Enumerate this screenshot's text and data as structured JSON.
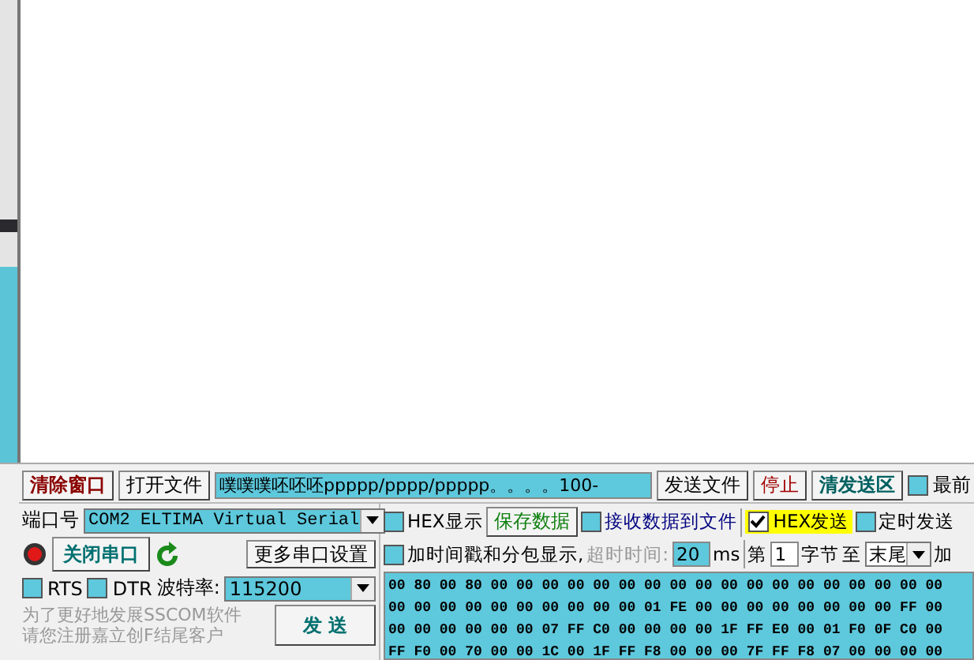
{
  "toolbar": {
    "clear_button": "清除窗口",
    "open_file_button": "打开文件",
    "send_input": "噗噗噗呸呸呸ppppp/pppp/ppppp。。。。100-",
    "send_file_button": "发送文件",
    "stop_button": "停止",
    "clear_send_button": "清发送区",
    "topmost": {
      "label": "最前",
      "checked": false
    }
  },
  "port": {
    "label": "端口号",
    "value": "COM2 ELTIMA Virtual Serial",
    "open": true,
    "close_button": "关闭串口",
    "more_button": "更多串口设置",
    "rts": {
      "label": "RTS",
      "checked": false
    },
    "dtr": {
      "label": "DTR",
      "checked": false
    },
    "baud_label": "波特率:",
    "baud_value": "115200"
  },
  "promo": [
    "为了更好地发展SSCOM软件",
    "请您注册嘉立创F结尾客户"
  ],
  "send_button": "发 送",
  "receive": {
    "hex_display": {
      "label": "HEX显示",
      "checked": false
    },
    "save_button": "保存数据",
    "to_file": {
      "label": "接收数据到文件",
      "checked": false
    },
    "timestamp": {
      "label": "加时间戳和分包显示,",
      "checked": false
    },
    "timeout_label": "超时时间:",
    "timeout_value": "20",
    "ms_label": "ms"
  },
  "send_options": {
    "hex_send": {
      "label": "HEX发送",
      "checked": true
    },
    "timed_send": {
      "label": "定时发送",
      "checked": false
    },
    "from_label": "第",
    "from_value": "1",
    "bytes_label": "字节",
    "to_label": "至",
    "to_value": "末尾",
    "trail": "加"
  },
  "hex_lines": [
    "00 80 00 80 00 00 00 00 00 00 00 00 00 00 00 00 00 00 00 00 00 00",
    "00 00 00 00 00 00 00 00 00 00 01 FE 00 00 00 00 00 00 00 00 FF 00",
    "00 00 00 00 00 00 07 FF C0 00 00 00 00 1F FF E0 00 01 F0 0F C0 00",
    "FF F0 00 70 00 00 1C 00 1F FF F8 00 00 00 7F FF F8 07 00 00 00 00"
  ]
}
